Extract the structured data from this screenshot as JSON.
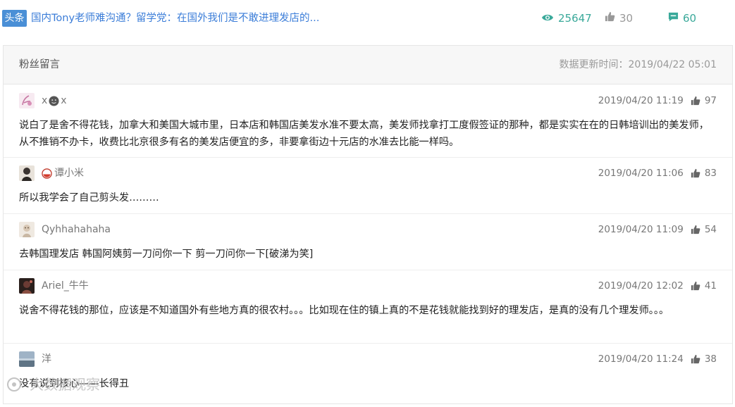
{
  "article": {
    "badge": "头条",
    "title": "国内Tony老师难沟通？留学党：在国外我们是不敢进理发店的...",
    "views": "25647",
    "likes": "30",
    "comments": "60"
  },
  "panel": {
    "title": "粉丝留言",
    "updated": "数据更新时间：2019/04/22 05:01"
  },
  "comments": [
    {
      "user_prefix": "x",
      "user_suffix": "x",
      "time": "2019/04/20 11:19",
      "likes": "97",
      "body": "说白了是舍不得花钱，加拿大和美国大城市里，日本店和韩国店美发水准不要太高，美发师找拿打工度假签证的那种，都是实实在在的日韩培训出的美发师，从不推销不办卡，收费比北京很多有名的美发店便宜的多，非要拿街边十元店的水准去比能一样吗。"
    },
    {
      "user": "谭小米",
      "time": "2019/04/20 11:06",
      "likes": "83",
      "body": "所以我学会了自己剪头发………"
    },
    {
      "user": "Qyhhahahaha",
      "time": "2019/04/20 11:09",
      "likes": "54",
      "body": "去韩国理发店 韩国阿姨剪一刀问你一下 剪一刀问你一下[破涕为笑]"
    },
    {
      "user": "Ariel_牛牛",
      "time": "2019/04/20 12:02",
      "likes": "41",
      "body": "说舍不得花钱的那位，应该是不知道国外有些地方真的很农村。。。比如现在住的镇上真的不是花钱就能找到好的理发店，是真的没有几个理发师。。。"
    },
    {
      "user": "洋",
      "time": "2019/04/20 11:24",
      "likes": "38",
      "body": "没有说到核心——长得丑"
    }
  ],
  "watermark": "大数据观察",
  "colors": {
    "accent_blue": "#3b7dd8",
    "badge_blue": "#4a8fd6",
    "stat_teal": "#3aa99a"
  }
}
